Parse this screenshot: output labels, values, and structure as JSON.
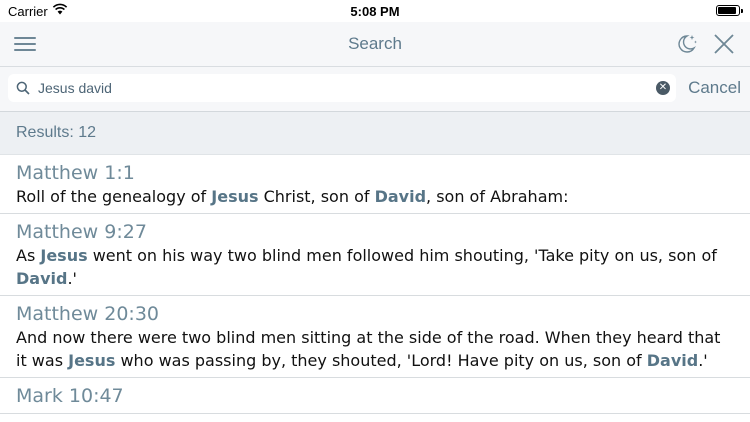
{
  "status_bar": {
    "carrier": "Carrier",
    "time": "5:08 PM",
    "battery_level": 0.92
  },
  "nav": {
    "title": "Search",
    "menu_icon": "hamburger-icon",
    "night_icon": "moon-stars-icon",
    "close_icon": "close-icon"
  },
  "search": {
    "value": "Jesus david",
    "placeholder": "",
    "cancel_label": "Cancel"
  },
  "results": {
    "label": "Results: 12"
  },
  "items": [
    {
      "ref": "Matthew 1:1",
      "segments": [
        {
          "t": "Roll of the genealogy of ",
          "h": false
        },
        {
          "t": "Jesus",
          "h": true
        },
        {
          "t": " Christ, son of ",
          "h": false
        },
        {
          "t": "David",
          "h": true
        },
        {
          "t": ", son of Abraham:",
          "h": false
        }
      ]
    },
    {
      "ref": "Matthew 9:27",
      "segments": [
        {
          "t": "As ",
          "h": false
        },
        {
          "t": "Jesus",
          "h": true
        },
        {
          "t": " went on his way two blind men followed him shouting, 'Take pity on us, son of ",
          "h": false
        },
        {
          "t": "David",
          "h": true
        },
        {
          "t": ".'",
          "h": false
        }
      ]
    },
    {
      "ref": "Matthew 20:30",
      "segments": [
        {
          "t": "And now there were two blind men sitting at the side of the road. When they heard that it was ",
          "h": false
        },
        {
          "t": "Jesus",
          "h": true
        },
        {
          "t": " who was passing by, they shouted, 'Lord! Have pity on us, son of ",
          "h": false
        },
        {
          "t": "David",
          "h": true
        },
        {
          "t": ".'",
          "h": false
        }
      ]
    },
    {
      "ref": "Mark 10:47",
      "segments": []
    }
  ],
  "colors": {
    "accent": "#5e7a8c",
    "highlight": "#577587",
    "bar_bg": "#f6f7f9"
  }
}
